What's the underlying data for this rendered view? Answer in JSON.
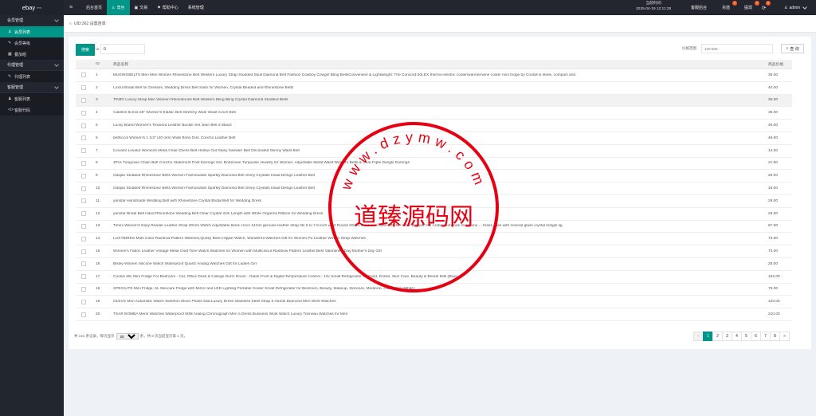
{
  "sidebar": {
    "logo": "ebay",
    "logo_sup": "PTN",
    "groups": [
      {
        "label": "会员管理",
        "items": [
          {
            "icon": "user-icon",
            "glyph": "♙",
            "label": "会员列表",
            "active": true
          },
          {
            "icon": "user-level-icon",
            "glyph": "✎",
            "label": "会员等级",
            "active": false
          },
          {
            "icon": "grid-icon",
            "glyph": "▦",
            "label": "叠加组",
            "active": false
          }
        ]
      },
      {
        "label": "代理管理",
        "items": [
          {
            "icon": "agent-icon",
            "glyph": "✎",
            "label": "代理列表",
            "active": false
          }
        ]
      },
      {
        "label": "客服管理",
        "items": [
          {
            "icon": "users-icon",
            "glyph": "♟",
            "label": "客服列表",
            "active": false
          },
          {
            "icon": "code-icon",
            "glyph": "</>",
            "label": "客服代码",
            "active": false
          }
        ]
      }
    ]
  },
  "topbar": {
    "menu_icon": "≡",
    "nav": [
      {
        "label": "后台首页",
        "icon": "",
        "active": false
      },
      {
        "label": "角色",
        "icon": "♙",
        "active": true
      },
      {
        "label": "交易",
        "icon": "▣",
        "active": false
      },
      {
        "label": "帮助中心",
        "icon": "⚑",
        "active": false
      },
      {
        "label": "系统管理",
        "icon": "",
        "active": false
      }
    ],
    "time_label": "当前时间",
    "time_value": "2025-04-19 12:11:28",
    "right": {
      "service": "客服后台",
      "recharge": "充值",
      "recharge_badge": "0",
      "withdraw": "提现",
      "withdraw_badge": "0",
      "refresh_icon": "⟳",
      "refresh_badge": "0",
      "user": "admin",
      "user_icon": "♙"
    }
  },
  "breadcrumb": "UID:362 设置连单",
  "filters": {
    "search_label": "搜索",
    "uid_prefix": "Ur",
    "uid_value": "0",
    "price_label": "价格范围",
    "price_placeholder": "100-500",
    "query_label": "查 询",
    "query_icon": "⌕"
  },
  "table": {
    "headers": {
      "id": "ID",
      "name": "商品名称",
      "price": "商品价格"
    },
    "rows": [
      {
        "id": "1",
        "name": "MUKINGBELTS Men Men Women Rhinestone Belt Western Luxury Strap Studded Skull Diamond Belt Fashion Cowboy Cowgirl Bling BeltsConvenient & Lightweight: The Concord-20LDX thermo-electric cooler/warmer/wine cooler mini fridge by Coolull is sleek, compact and",
        "price": "35.00"
      },
      {
        "id": "2",
        "name": "Loxful Bridal Belt for Dresses, Wedding Dress Belt Sash for Women, Crystal Beaded and Rhinestone Belts",
        "price": "40.00"
      },
      {
        "id": "3",
        "name": "TINIDI Luxury Strap Men Women Rhinestones Belt Western Bling Bling Crystal Diamond Studded Belts",
        "price": "35.00"
      },
      {
        "id": "4",
        "name": "Catelles 8cm/2.36\" Women's Elastic Belt Stretchy Wide Waist Cinch Belt",
        "price": "35.00"
      },
      {
        "id": "5",
        "name": "Lucky Brand Women's Textured Leather Buckle Set Jean Belt in Black",
        "price": "49.00"
      },
      {
        "id": "6",
        "name": "bethiccol Women's 1 1/2\" (40 mm) Wide Boho Disc Concho Leather Belt",
        "price": "46.00"
      },
      {
        "id": "7",
        "name": "ILovator Lovator Womens Metal Chain Dress Belt Hollow Out Daisy Sweater Belt Decorated Skinny Waist Belt",
        "price": "14.00"
      },
      {
        "id": "8",
        "name": "4Pcs Turquoise Chain Belt Concho Statement Post Earrings Set, Bohemian Turquoise Jewelry for Women, Adjustable Metal Waist Western Belts & Oval Triple Dangle Earrings",
        "price": "21.00"
      },
      {
        "id": "9",
        "name": "Gatijan Studded Rhinestone Belts Women Fashionable Sparkly Diamond Belt Shiny Crystals Inlaid Design Leather Belt",
        "price": "26.00"
      },
      {
        "id": "10",
        "name": "Gatijan Studded Rhinestone Belts Women Fashionable Sparkly Diamond Belt Shiny Crystals Inlaid Design Leather Belt",
        "price": "16.00"
      },
      {
        "id": "11",
        "name": "yanstar Handmade Wedding Belt with Rhinestone Crystal Bridal Belt for Wedding Dress",
        "price": "29.00"
      },
      {
        "id": "12",
        "name": "yanstar Bridal Belt Hand Rhinestone Wedding Belt Clear Crystal 22in Length with White Organza Ribbon for Wedding Dress",
        "price": "25.00"
      },
      {
        "id": "13",
        "name": "Timex Women's Easy Reader Leather Strap 30mm Watch Adjustable black croco 14mm genuine leather strap fits 6 to 7.5-inch wrist Round 30mm Gold-tone case with full white dial with full Arabic numerals Gold-tone ... brass case with mineral glass crystal Indiglo lig",
        "price": "87.00"
      },
      {
        "id": "14",
        "name": "LUXYBIRDS Multi Color Rainbow Pattern Watches,Quirky Boho Hippie Watch, Wonderful Watches Gift for Women,Pu Leather Woven Strap Watches",
        "price": "73.00"
      },
      {
        "id": "15",
        "name": "Women's Fabric Leather Vintage Metal Gold Tone Watch,Watches for Women with Multicolour Rainbow Pattern Leather,Best Valentine's Day Mother's Day Gift",
        "price": "73.00"
      },
      {
        "id": "16",
        "name": "Bisley Women Silicone Watch Waterproof Quartz Analog Watches Gift for Ladies Girl",
        "price": "28.00"
      },
      {
        "id": "17",
        "name": "Cooluli 20L Mini Fridge For Bedroom - Car, Office Desk & College Dorm Room - Glass Front & Digital Temperature Control - 12v Small Refrigerator for Food, Drinks, Skin Care, Beauty & Breast Milk (Blue)",
        "price": "152.00"
      },
      {
        "id": "18",
        "name": "SPECILITE Mini Fridge, 6L Skincare Fridge with Mirror and LED Lighting Portable Cooler Small Refrigerator for Bedroom, Beauty, Makeup, Skincare, Medicine, Cosmetics (White)",
        "price": "76.00"
      },
      {
        "id": "19",
        "name": "OLEVS Men Automatic Watch Skeleton Moon Phase Dial Luxury Dress Stainless Steel Strap 5 Hands Diamond Men Wrist Watches",
        "price": "120.00"
      },
      {
        "id": "20",
        "name": "TSAR BOMBA Mens Watches Waterproof 50M Analog Chronograph Men´s Dress Business Work Watch Luxury Tonneau Watches for Men",
        "price": "210.00"
      }
    ]
  },
  "pager": {
    "info_prefix": "共 141 条记录，每页显示",
    "per_page": "20",
    "info_suffix": "条，共 8 页当前显示第 1 页。",
    "prev": "«",
    "pages": [
      "1",
      "2",
      "3",
      "4",
      "5",
      "6",
      "7",
      "8"
    ],
    "current": "1",
    "next": "»"
  },
  "watermark": {
    "text": "道臻源码网",
    "ring_text": "www.dzymw.com"
  },
  "colors": {
    "accent": "#009688",
    "sidebar_bg": "#22262e",
    "stamp_red": "#e60012",
    "badge": "#ff5722"
  }
}
